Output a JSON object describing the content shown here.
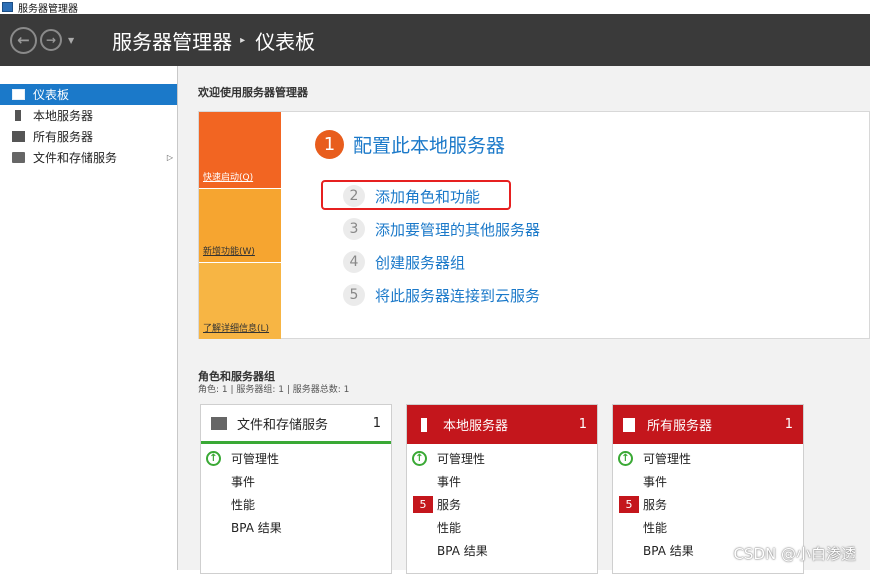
{
  "window": {
    "title": "服务器管理器"
  },
  "header": {
    "back_icon": "arrow-left-icon",
    "forward_icon": "arrow-right-icon",
    "breadcrumb_root": "服务器管理器",
    "breadcrumb_sep": "▸",
    "breadcrumb_current": "仪表板"
  },
  "sidebar": {
    "items": [
      {
        "label": "仪表板",
        "icon": "dashboard-grid-icon",
        "active": true
      },
      {
        "label": "本地服务器",
        "icon": "server-icon"
      },
      {
        "label": "所有服务器",
        "icon": "servers-icon"
      },
      {
        "label": "文件和存储服务",
        "icon": "file-storage-icon",
        "expand": "▷"
      }
    ]
  },
  "welcome": {
    "title": "欢迎使用服务器管理器",
    "tiles": [
      "快速启动(Q)",
      "新增功能(W)",
      "了解详细信息(L)"
    ],
    "step1": {
      "num": "1",
      "label": "配置此本地服务器"
    },
    "steps": [
      {
        "num": "2",
        "label": "添加角色和功能"
      },
      {
        "num": "3",
        "label": "添加要管理的其他服务器"
      },
      {
        "num": "4",
        "label": "创建服务器组"
      },
      {
        "num": "5",
        "label": "将此服务器连接到云服务"
      }
    ]
  },
  "roles": {
    "title": "角色和服务器组",
    "subtitle": "角色: 1 | 服务器组: 1 | 服务器总数: 1",
    "cards": [
      {
        "title": "文件和存储服务",
        "count": "1",
        "status_color": "#3aa935",
        "rows": [
          "可管理性",
          "事件",
          "性能",
          "BPA 结果"
        ]
      },
      {
        "title": "本地服务器",
        "count": "1",
        "status_color": "#c4161c",
        "rows": [
          "可管理性",
          "事件",
          "服务",
          "性能",
          "BPA 结果"
        ],
        "service_badge": "5"
      },
      {
        "title": "所有服务器",
        "count": "1",
        "status_color": "#c4161c",
        "rows": [
          "可管理性",
          "事件",
          "服务",
          "性能",
          "BPA 结果"
        ],
        "service_badge": "5"
      }
    ]
  },
  "watermark": "CSDN @小白渗透",
  "colors": {
    "accent": "#1b79c9",
    "orange": "#f26522",
    "red": "#c4161c",
    "green": "#3aa935"
  }
}
